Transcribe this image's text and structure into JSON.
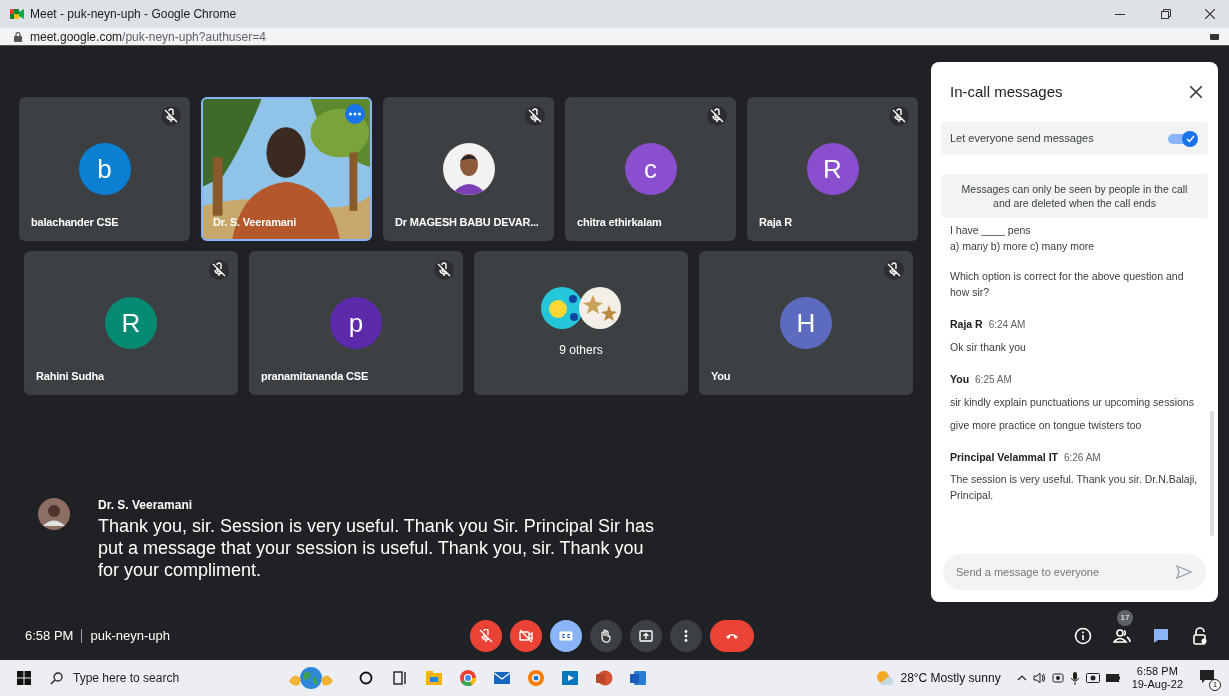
{
  "window": {
    "title": "Meet - puk-neyn-uph - Google Chrome"
  },
  "address_bar": {
    "host": "meet.google.com",
    "path": "/puk-neyn-uph?authuser=4"
  },
  "tiles": [
    {
      "kind": "avatar",
      "name": "balachander CSE",
      "letter": "b",
      "color": "#0b7fd1",
      "muted": true,
      "highlighted": false
    },
    {
      "kind": "video",
      "name": "Dr. S. Veeramani",
      "muted": false,
      "highlighted": true
    },
    {
      "name": "Dr MAGESH BABU DEVAR...",
      "muted": true,
      "highlighted": false
    },
    {
      "kind": "avatar",
      "name": "chitra ethirkalam",
      "letter": "c",
      "color": "#8a4fcf",
      "muted": true,
      "highlighted": false
    },
    {
      "kind": "avatar",
      "name": "Raja R",
      "letter": "R",
      "color": "#8a4fcf",
      "muted": true,
      "highlighted": false
    },
    {
      "kind": "avatar",
      "name": "Rahini Sudha",
      "letter": "R",
      "color": "#078a74",
      "muted": true,
      "highlighted": false
    },
    {
      "kind": "avatar",
      "name": "pranamitananda CSE",
      "letter": "p",
      "color": "#5c2aab",
      "muted": true,
      "highlighted": false
    },
    {
      "kind": "group",
      "name": "9 others",
      "muted": false,
      "highlighted": false
    },
    {
      "kind": "avatar",
      "name": "You",
      "letter": "H",
      "color": "#5c6bc0",
      "muted": true,
      "highlighted": false
    }
  ],
  "caption": {
    "speaker": "Dr. S. Veeramani",
    "text": "Thank you, sir. Session is very useful. Thank you Sir. Principal Sir has put a message that your session is useful. Thank you, sir. Thank you for your compliment."
  },
  "meeting": {
    "time": "6:58 PM",
    "code": "puk-neyn-uph"
  },
  "controls": [
    {
      "kind": "mic",
      "on": false
    },
    {
      "kind": "camera",
      "on": false
    },
    {
      "kind": "captions",
      "on": true
    },
    {
      "kind": "hand",
      "on": false
    },
    {
      "kind": "present",
      "on": false
    },
    {
      "kind": "more",
      "on": false
    },
    {
      "kind": "leave"
    }
  ],
  "side_buttons": [
    {
      "kind": "info",
      "selected": false
    },
    {
      "kind": "people",
      "selected": false,
      "badge": "17"
    },
    {
      "kind": "chat",
      "selected": true
    },
    {
      "kind": "activities",
      "selected": false
    }
  ],
  "chat": {
    "title": "In-call messages",
    "setting": {
      "label": "Let everyone send messages",
      "on": true
    },
    "notice": "Messages can only be seen by people in the call and are deleted when the call ends",
    "messages": [
      {
        "texts": [
          "I have ____ pens\na) many   b) more  c) many more",
          "Which option is correct for the above question and how sir?"
        ]
      },
      {
        "sender": "Raja R",
        "time": "6:24 AM",
        "texts": [
          "Ok sir thank you"
        ]
      },
      {
        "sender": "You",
        "time": "6:25 AM",
        "texts": [
          "sir  kindly explain punctuations ur upcoming sessions",
          "give more practice on tongue twisters  too"
        ]
      },
      {
        "sender": "Principal Velammal IT",
        "time": "6:26 AM",
        "texts": [
          "The session is very useful.  Thank you sir. Dr.N.Balaji, Principal."
        ]
      }
    ],
    "input_placeholder": "Send a message to everyone"
  },
  "taskbar": {
    "search_placeholder": "Type here to search",
    "weather": "28°C  Mostly sunny",
    "clock_time": "6:58 PM",
    "clock_date": "19-Aug-22",
    "notification_count": "1"
  }
}
